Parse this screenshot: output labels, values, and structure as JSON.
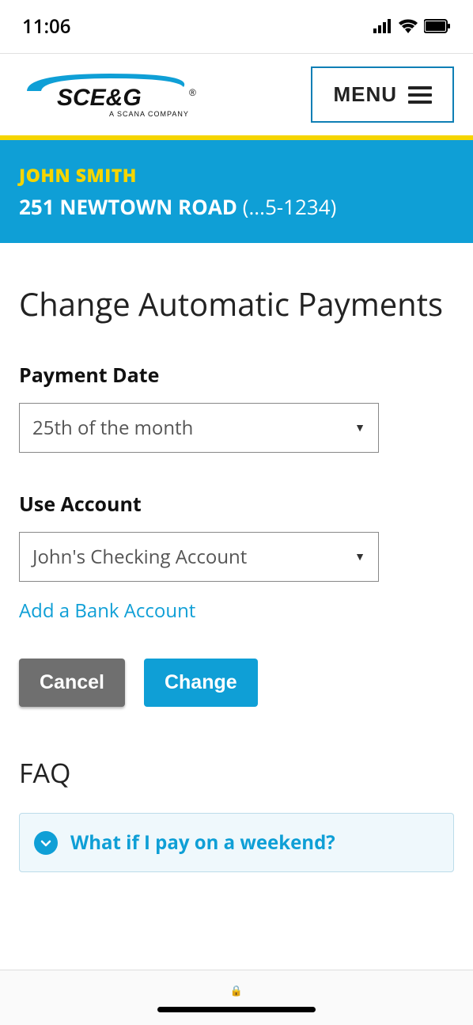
{
  "status_bar": {
    "time": "11:06"
  },
  "header": {
    "logo_main": "SCE&G",
    "logo_reg": "®",
    "logo_sub": "A SCANA COMPANY",
    "menu_label": "MENU"
  },
  "account": {
    "name": "JOHN SMITH",
    "address": "251 NEWTOWN ROAD",
    "masked_number": "(...5-1234)"
  },
  "page": {
    "title": "Change Automatic Payments"
  },
  "payment_date": {
    "label": "Payment Date",
    "selected": "25th of the month"
  },
  "use_account": {
    "label": "Use Account",
    "selected": "John's Checking Account",
    "add_link": "Add a Bank Account"
  },
  "buttons": {
    "cancel": "Cancel",
    "change": "Change"
  },
  "faq": {
    "title": "FAQ",
    "items": [
      {
        "question": "What if I pay on a weekend?"
      }
    ]
  }
}
